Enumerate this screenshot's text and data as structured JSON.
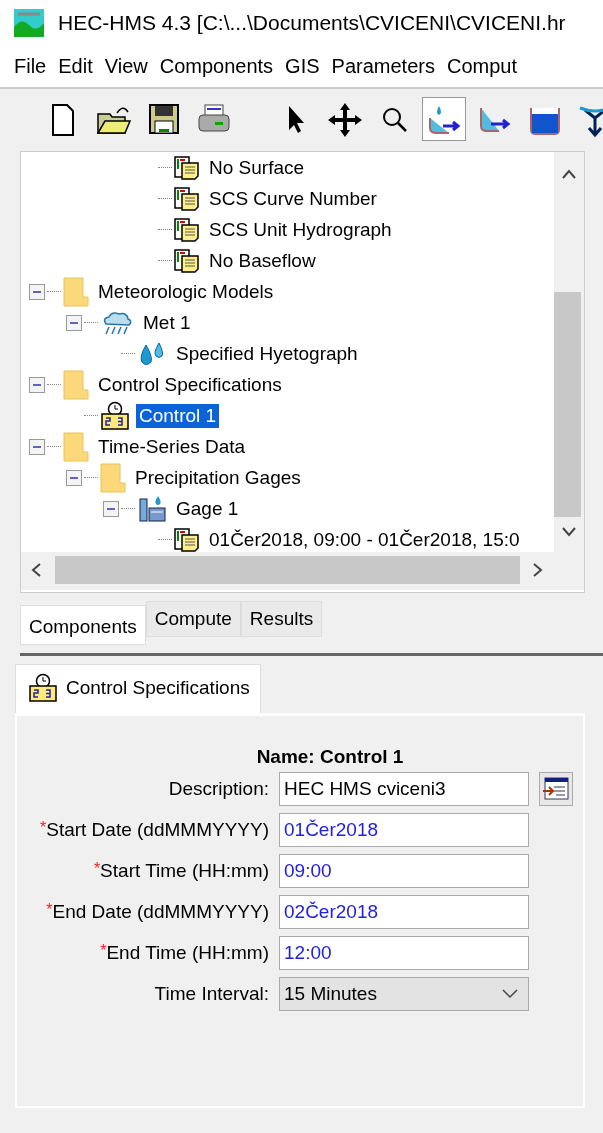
{
  "window": {
    "title": "HEC-HMS 4.3 [C:\\...\\Documents\\CVICENI\\CVICENI.hr"
  },
  "menu": [
    "File",
    "Edit",
    "View",
    "Components",
    "GIS",
    "Parameters",
    "Comput"
  ],
  "toolbar": [
    {
      "kind": "new",
      "selected": false
    },
    {
      "kind": "open",
      "selected": false
    },
    {
      "kind": "save",
      "selected": false
    },
    {
      "kind": "print",
      "selected": false
    },
    {
      "kind": "separator"
    },
    {
      "kind": "pointer",
      "selected": false
    },
    {
      "kind": "move",
      "selected": false
    },
    {
      "kind": "zoom",
      "selected": false
    },
    {
      "kind": "subbasin",
      "selected": true
    },
    {
      "kind": "reach",
      "selected": false
    },
    {
      "kind": "reservoir",
      "selected": false
    },
    {
      "kind": "junction",
      "selected": false
    }
  ],
  "tree": {
    "continued_items": [
      {
        "label": "No Surface",
        "kind": "method",
        "selected": false
      },
      {
        "label": "SCS Curve Number",
        "kind": "method",
        "selected": false
      },
      {
        "label": "SCS Unit Hydrograph",
        "kind": "method",
        "selected": false
      },
      {
        "label": "No Baseflow",
        "kind": "method",
        "selected": false
      }
    ],
    "items": [
      {
        "label": "Meteorologic Models",
        "kind": "folder",
        "selected": false,
        "expanded": true,
        "children": [
          {
            "label": "Met 1",
            "kind": "met",
            "selected": false,
            "expanded": true,
            "children": [
              {
                "label": "Specified Hyetograph",
                "kind": "hyetograph",
                "selected": false
              }
            ]
          }
        ]
      },
      {
        "label": "Control Specifications",
        "kind": "folder",
        "selected": false,
        "expanded": true,
        "children": [
          {
            "label": "Control 1",
            "kind": "control",
            "selected": true
          }
        ]
      },
      {
        "label": "Time-Series Data",
        "kind": "folder",
        "selected": false,
        "expanded": true,
        "children": [
          {
            "label": "Precipitation Gages",
            "kind": "folder",
            "selected": false,
            "expanded": true,
            "children": [
              {
                "label": "Gage 1",
                "kind": "gage",
                "selected": false,
                "expanded": true,
                "children": [
                  {
                    "label": "01Čer2018, 09:00 - 01Čer2018, 15:0",
                    "kind": "method",
                    "selected": false
                  }
                ]
              }
            ]
          }
        ]
      }
    ]
  },
  "tabs": [
    {
      "label": "Components",
      "selected": true
    },
    {
      "label": "Compute",
      "selected": false
    },
    {
      "label": "Results",
      "selected": false
    }
  ],
  "editor": {
    "tab": {
      "label": "Control Specifications",
      "selected": true
    },
    "name": "Name: Control 1",
    "fields": [
      {
        "label": "Description:",
        "value": "HEC HMS cviceni3",
        "kind": "text"
      },
      {
        "label": "Start Date (ddMMMYYYY)",
        "required_mark": "*",
        "value": "01Čer2018",
        "kind": "formatted"
      },
      {
        "label": "Start Time (HH:mm)",
        "required_mark": "*",
        "value": "09:00",
        "kind": "formatted"
      },
      {
        "label": "End Date (ddMMMYYYY)",
        "required_mark": "*",
        "value": "02Čer2018",
        "kind": "formatted"
      },
      {
        "label": "End Time (HH:mm)",
        "required_mark": "*",
        "value": "12:00",
        "kind": "formatted"
      },
      {
        "label": "Time Interval:",
        "value": "15 Minutes",
        "kind": "select"
      }
    ]
  }
}
